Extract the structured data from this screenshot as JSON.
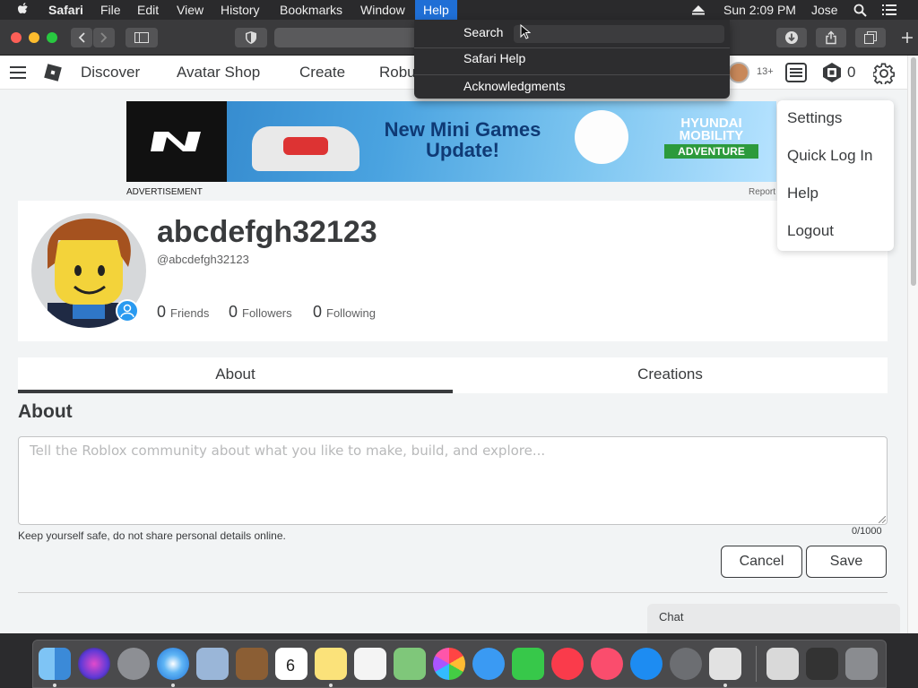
{
  "menubar": {
    "app": "Safari",
    "items": [
      "File",
      "Edit",
      "View",
      "History",
      "Bookmarks",
      "Window",
      "Help"
    ],
    "clock": "Sun 2:09 PM",
    "user": "Jose"
  },
  "help_menu": {
    "search_label": "Search",
    "items": [
      "Safari Help",
      "Acknowledgments"
    ]
  },
  "nav": {
    "links": [
      "Discover",
      "Avatar Shop",
      "Create",
      "Robu"
    ],
    "age_badge": "13+",
    "robux": "0"
  },
  "settings_menu": [
    "Settings",
    "Quick Log In",
    "Help",
    "Logout"
  ],
  "ad": {
    "headline_1": "New Mini Games",
    "headline_2": "Update!",
    "brand_1": "HYUNDAI",
    "brand_2": "MOBILITY",
    "tagline": "ADVENTURE",
    "label": "ADVERTISEMENT",
    "report": "Report"
  },
  "profile": {
    "username": "abcdefgh32123",
    "handle": "@abcdefgh32123",
    "stats": [
      {
        "count": "0",
        "label": "Friends"
      },
      {
        "count": "0",
        "label": "Followers"
      },
      {
        "count": "0",
        "label": "Following"
      }
    ]
  },
  "tabs": [
    "About",
    "Creations"
  ],
  "about": {
    "heading": "About",
    "placeholder": "Tell the Roblox community about what you like to make, build, and explore...",
    "safety_note": "Keep yourself safe, do not share personal details online.",
    "counter": "0/1000",
    "cancel": "Cancel",
    "save": "Save"
  },
  "chat": "Chat",
  "colors": {
    "menu_highlight": "#1f6fd6",
    "page_bg": "#f2f4f5",
    "text": "#393b3d"
  }
}
